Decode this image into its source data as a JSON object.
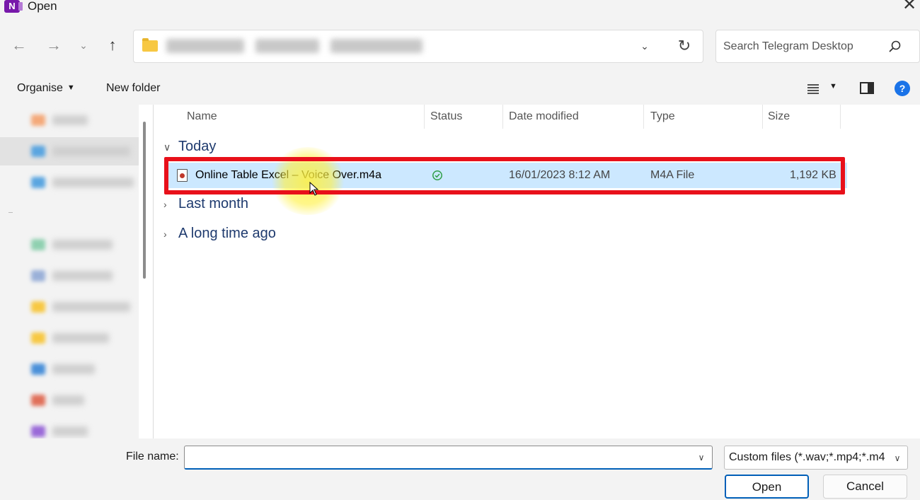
{
  "window": {
    "title": "Open",
    "app_icon_letter": "N"
  },
  "nav": {
    "back_icon": "arrow-left-icon",
    "forward_icon": "arrow-right-icon",
    "recent_icon": "chevron-down-icon",
    "up_icon": "arrow-up-icon"
  },
  "search": {
    "placeholder": "Search Telegram Desktop"
  },
  "toolbar": {
    "organise_label": "Organise",
    "new_folder_label": "New folder"
  },
  "columns": {
    "name": "Name",
    "status": "Status",
    "date_modified": "Date modified",
    "type": "Type",
    "size": "Size"
  },
  "groups": {
    "today": "Today",
    "last_month": "Last month",
    "long_ago": "A long time ago"
  },
  "file": {
    "name": "Online Table Excel – Voice Over.m4a",
    "date_modified": "16/01/2023 8:12 AM",
    "type": "M4A File",
    "size": "1,192 KB",
    "status_icon": "synced-check-icon"
  },
  "bottom": {
    "file_name_label": "File name:",
    "file_name_value": "",
    "filter_value": "Custom files (*.wav;*.mp4;*.m4",
    "open_label": "Open",
    "cancel_label": "Cancel"
  },
  "colors": {
    "selection": "#cce8ff",
    "highlight_box": "#e8101a",
    "accent": "#005fb8",
    "group_text": "#1e3a6e"
  }
}
